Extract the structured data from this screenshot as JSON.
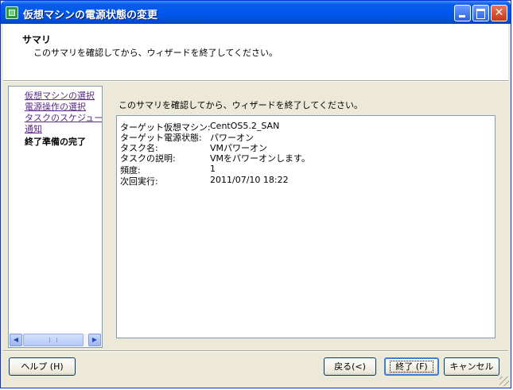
{
  "window": {
    "title": "仮想マシンの電源状態の変更",
    "controls": {
      "close_glyph": "✕"
    }
  },
  "header": {
    "title": "サマリ",
    "description": "このサマリを確認してから、ウィザードを終了してください。"
  },
  "nav": {
    "items": [
      {
        "label": "仮想マシンの選択",
        "state": "link"
      },
      {
        "label": "電源操作の選択",
        "state": "link"
      },
      {
        "label": "タスクのスケジュール設定",
        "state": "link"
      },
      {
        "label": "通知",
        "state": "link"
      },
      {
        "label": "終了準備の完了",
        "state": "current"
      }
    ],
    "scroll": {
      "left_glyph": "◀",
      "right_glyph": "▶"
    }
  },
  "main": {
    "description": "このサマリを確認してから、ウィザードを終了してください。",
    "summary": [
      {
        "key": "ターゲット仮想マシン:",
        "value": "CentOS5.2_SAN"
      },
      {
        "key": "ターゲット電源状態:",
        "value": "パワーオン"
      },
      {
        "key": "タスク名:",
        "value": "VMパワーオン"
      },
      {
        "key": "タスクの説明:",
        "value": "VMをパワーオンします。"
      },
      {
        "key": "頻度:",
        "value": "1"
      },
      {
        "key": "次回実行:",
        "value": "2011/07/10 18:22"
      }
    ]
  },
  "buttons": {
    "help": "ヘルプ (H)",
    "back": "戻る(<)",
    "finish": "終了 (F)",
    "cancel": "キャンセル"
  },
  "colors": {
    "titlebar": "#0058ee",
    "link": "#5b2a86",
    "face": "#ece9d8"
  }
}
